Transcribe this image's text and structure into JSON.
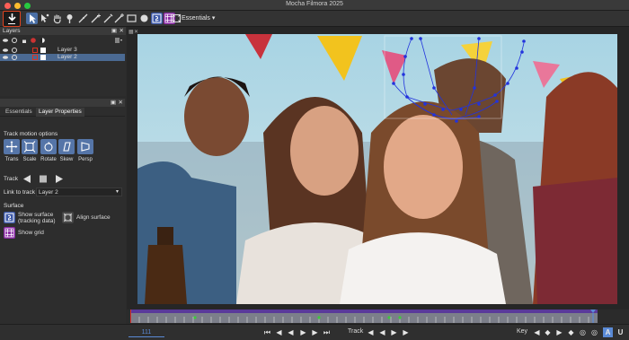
{
  "window": {
    "title": "Mocha Filmora 2025"
  },
  "toolbar": {
    "workspace": "Essentials"
  },
  "layers_panel": {
    "title": "Layers",
    "layers": [
      {
        "name": "Layer 3",
        "selected": false
      },
      {
        "name": "Layer 2",
        "selected": true
      }
    ]
  },
  "properties_panel": {
    "tabs": [
      "Essentials",
      "Layer Properties"
    ],
    "active_tab": "Layer Properties",
    "track_motion_title": "Track motion options",
    "motion_options": [
      "Trans",
      "Scale",
      "Rotate",
      "Skew",
      "Persp"
    ],
    "track_label": "Track",
    "link_to_track_label": "Link to track",
    "link_to_track_value": "Layer 2",
    "surface_title": "Surface",
    "show_surface_label": "Show surface\n(tracking data)",
    "align_surface_label": "Align surface",
    "show_grid_label": "Show grid"
  },
  "bottom_bar": {
    "frame_value": "111",
    "track_label": "Track",
    "key_label": "Key",
    "key_a_label": "A",
    "key_u_label": "U"
  },
  "colors": {
    "accent": "#5a8ad6",
    "selected_layer": "#4b6a93",
    "export_outline": "#e0431f",
    "tracking_points": "#2233dd"
  }
}
